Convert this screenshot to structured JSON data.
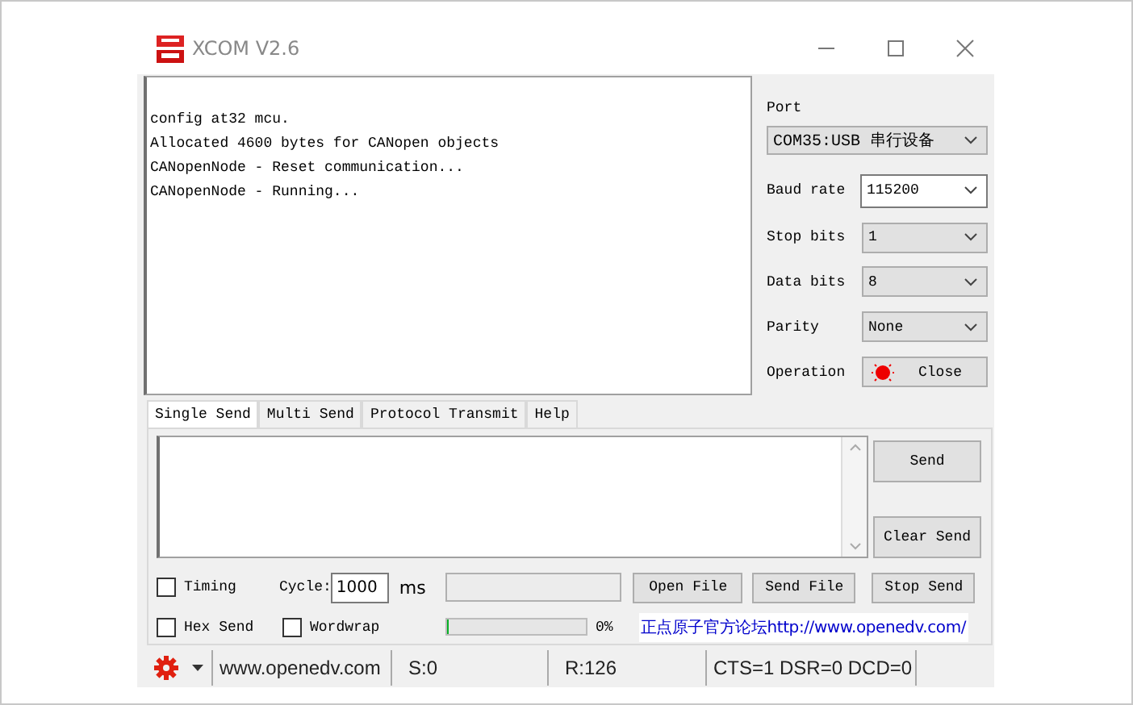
{
  "window": {
    "title": "XCOM V2.6"
  },
  "receive": {
    "lines": [
      "config at32 mcu.",
      "Allocated 4600 bytes for CANopen objects",
      "CANopenNode - Reset communication...",
      "CANopenNode - Running..."
    ]
  },
  "settings": {
    "port": {
      "label": "Port",
      "value": "COM35:USB 串行设备"
    },
    "fields": [
      {
        "label": "Baud rate",
        "value": "115200",
        "kind": "combo"
      },
      {
        "label": "Stop bits",
        "value": "1",
        "kind": "select"
      },
      {
        "label": "Data bits",
        "value": "8",
        "kind": "select"
      },
      {
        "label": "Parity",
        "value": "None",
        "kind": "select"
      }
    ],
    "operation": {
      "label": "Operation",
      "button": "Close",
      "active": true
    }
  },
  "tabs": [
    {
      "label": "Single Send",
      "selected": true
    },
    {
      "label": "Multi Send",
      "selected": false
    },
    {
      "label": "Protocol Transmit",
      "selected": false
    },
    {
      "label": "Help",
      "selected": false
    }
  ],
  "send": {
    "buttons": [
      "Send",
      "Clear Send"
    ]
  },
  "options": {
    "timing": {
      "label": "Timing",
      "checked": false
    },
    "cycle": {
      "label": "Cycle:",
      "value": "1000",
      "unit": "ms"
    },
    "hex_send": {
      "label": "Hex Send",
      "checked": false
    },
    "wordwrap": {
      "label": "Wordwrap",
      "checked": false
    },
    "file_buttons": [
      "Open File",
      "Send File",
      "Stop Send"
    ],
    "progress": {
      "level": 0,
      "reading": "0%"
    },
    "link": "正点原子官方论坛http://www.openedv.com/"
  },
  "status_bar": {
    "site": "www.openedv.com",
    "sent": "S:0",
    "received": "R:126",
    "signals": "CTS=1 DSR=0 DCD=0"
  }
}
